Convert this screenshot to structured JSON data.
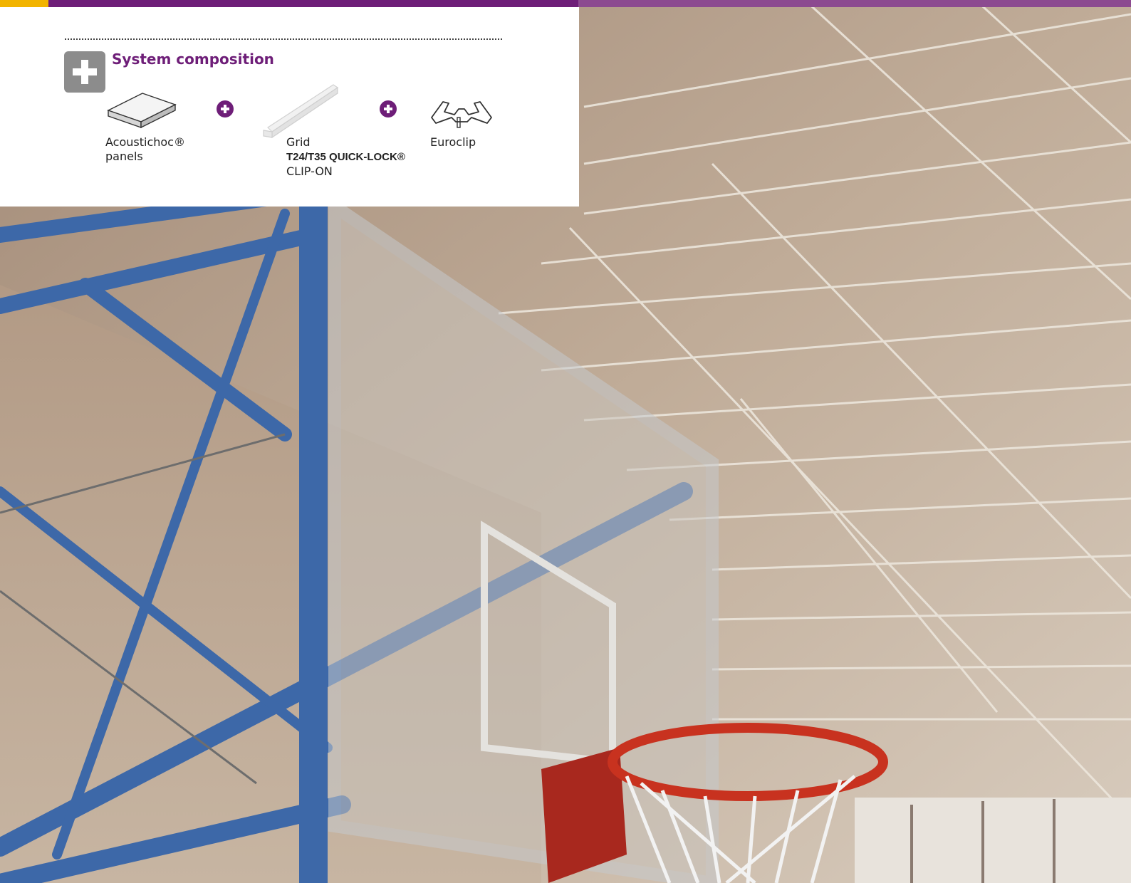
{
  "header": {
    "accent_color": "#f2b400",
    "bar_color": "#6e1e78"
  },
  "system_composition": {
    "icon": "plus-box-icon",
    "title": "System composition",
    "components": [
      {
        "icon": "ceiling-panel-icon",
        "line1": "Acoustichoc®",
        "line2": "panels"
      },
      {
        "icon": "grid-profile-icon",
        "line1": "Grid",
        "line2": "T24/T35 QUICK-LOCK®",
        "line3": "CLIP-ON"
      },
      {
        "icon": "euroclip-icon",
        "line1": "Euroclip"
      }
    ],
    "separator_icon": "plus-circle-icon"
  },
  "photo": {
    "subject": "basketball-hoop-under-acoustic-ceiling"
  }
}
